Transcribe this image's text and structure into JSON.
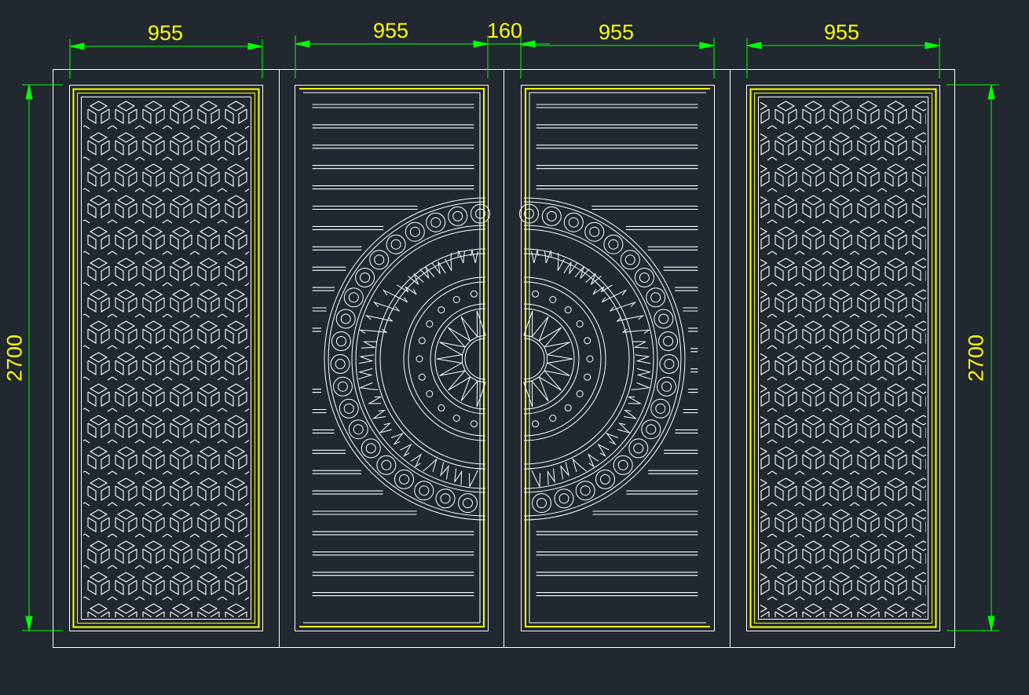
{
  "drawing": {
    "colors": {
      "background": "#212830",
      "outline": "#ffffff",
      "frame": "#ffff00",
      "dimension": "#00ff00",
      "dimension_text": "#ffff00"
    },
    "panels": [
      {
        "name": "panel-left",
        "pattern": "cube-lattice"
      },
      {
        "name": "panel-center-left",
        "pattern": "slats-with-half-medallion"
      },
      {
        "name": "panel-center-right",
        "pattern": "slats-with-half-medallion"
      },
      {
        "name": "panel-right",
        "pattern": "cube-lattice"
      }
    ],
    "dimensions": {
      "width_1": "955",
      "width_2": "955",
      "gap": "160",
      "width_3": "955",
      "width_4": "955",
      "height_left": "2700",
      "height_right": "2700"
    }
  }
}
